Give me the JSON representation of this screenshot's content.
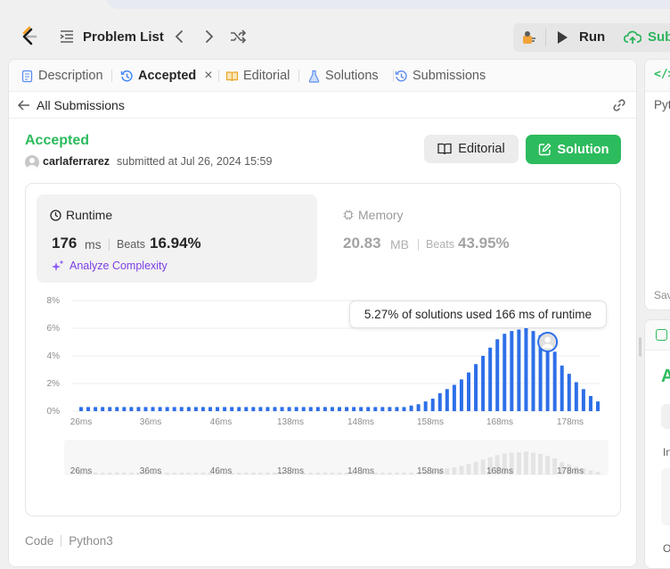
{
  "header": {
    "problem_list_label": "Problem List",
    "run_label": "Run",
    "submit_label": "Sub"
  },
  "tabs": [
    {
      "label": "Description",
      "icon": "description-icon",
      "active": false
    },
    {
      "label": "Accepted",
      "icon": "history-icon",
      "active": true
    },
    {
      "label": "Editorial",
      "icon": "book-icon",
      "active": false
    },
    {
      "label": "Solutions",
      "icon": "flask-icon",
      "active": false
    },
    {
      "label": "Submissions",
      "icon": "history-icon",
      "active": false
    }
  ],
  "subbar": {
    "back_label": "All Submissions"
  },
  "submission": {
    "status": "Accepted",
    "username": "carlaferrarez",
    "submitted_text": "submitted at Jul 26, 2024 15:59",
    "editorial_button": "Editorial",
    "solution_button": "Solution"
  },
  "runtime": {
    "title": "Runtime",
    "value": "176",
    "unit": "ms",
    "beats_label": "Beats",
    "beats_value": "16.94%",
    "analyze_label": "Analyze Complexity"
  },
  "memory": {
    "title": "Memory",
    "value": "20.83",
    "unit": "MB",
    "beats_label": "Beats",
    "beats_value": "43.95%"
  },
  "tooltip": "5.27% of solutions used 166 ms of runtime",
  "chart_data": {
    "type": "bar",
    "y_ticks": [
      "8%",
      "6%",
      "4%",
      "2%",
      "0%"
    ],
    "ylim": [
      0,
      8
    ],
    "x_tick_labels": [
      "26ms",
      "36ms",
      "46ms",
      "138ms",
      "148ms",
      "158ms",
      "168ms",
      "178ms"
    ],
    "values": [
      0.3,
      0.3,
      0.3,
      0.3,
      0.3,
      0.3,
      0.3,
      0.3,
      0.3,
      0.3,
      0.3,
      0.3,
      0.3,
      0.3,
      0.3,
      0.3,
      0.3,
      0.3,
      0.3,
      0.3,
      0.3,
      0.3,
      0.3,
      0.3,
      0.3,
      0.3,
      0.3,
      0.3,
      0.3,
      0.3,
      0.3,
      0.3,
      0.3,
      0.3,
      0.3,
      0.3,
      0.3,
      0.3,
      0.3,
      0.3,
      0.3,
      0.3,
      0.3,
      0.3,
      0.3,
      0.3,
      0.4,
      0.5,
      0.7,
      0.9,
      1.3,
      1.6,
      1.9,
      2.3,
      2.8,
      3.4,
      4.0,
      4.6,
      5.2,
      5.6,
      5.8,
      5.9,
      6.1,
      5.8,
      5.5,
      5.0,
      4.3,
      3.3,
      2.7,
      2.1,
      1.6,
      1.1,
      0.7
    ],
    "highlight_index": 65,
    "bar_color": "#2d6fe8",
    "grid": true
  },
  "code_row": {
    "label": "Code",
    "language": "Python3"
  },
  "right_panel": {
    "code_icon": "</>",
    "language": "Pyt",
    "saved": "Sav",
    "accepted_letter": "A",
    "input_letter": "In",
    "output_letter": "O"
  }
}
